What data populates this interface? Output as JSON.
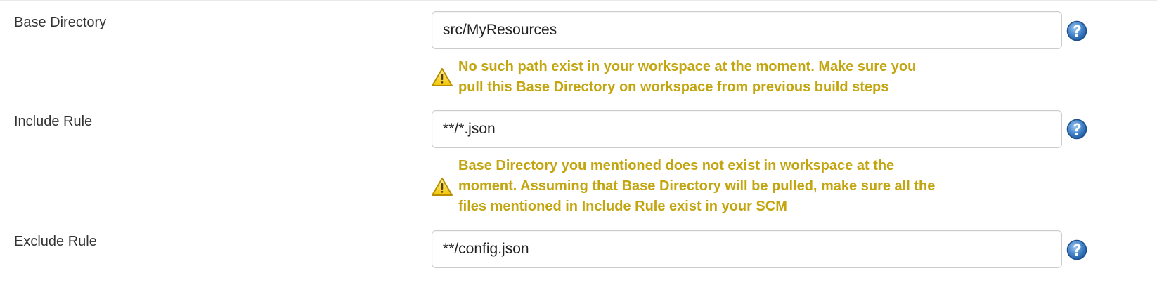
{
  "form": {
    "base_directory": {
      "label": "Base Directory",
      "value": "src/MyResources",
      "warning_lines": [
        "No such path exist in your workspace at the moment. Make sure you",
        "pull this Base Directory on workspace from previous build steps"
      ]
    },
    "include_rule": {
      "label": "Include Rule",
      "value": "**/*.json",
      "warning_lines": [
        "Base Directory you mentioned does not exist in workspace at the",
        "moment. Assuming that Base Directory will be pulled, make sure all the",
        "files mentioned in Include Rule exist in your SCM"
      ]
    },
    "exclude_rule": {
      "label": "Exclude Rule",
      "value": "**/config.json"
    }
  },
  "icons": {
    "help": "help-icon",
    "warning": "warning-icon"
  },
  "colors": {
    "warning_text": "#c3a50f",
    "help_blue": "#2b6db3",
    "field_border": "#cccccc",
    "label_text": "#333333"
  }
}
